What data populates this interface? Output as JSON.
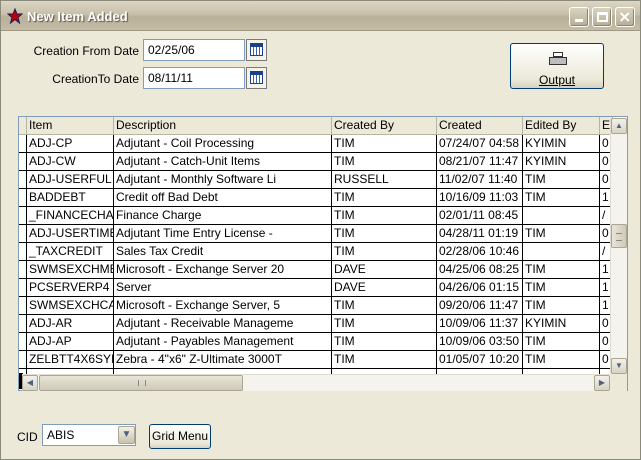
{
  "window": {
    "title": "New Item Added",
    "buttons": {
      "minimize": "minimize",
      "maximize": "maximize",
      "close": "×"
    }
  },
  "filters": {
    "creation_from_label": "Creation From Date",
    "creation_from_value": "02/25/06",
    "creation_to_label": "CreationTo Date",
    "creation_to_value": "08/11/11"
  },
  "output_button": {
    "label": "Output",
    "icon": "printer-icon"
  },
  "grid": {
    "columns": [
      "Item",
      "Description",
      "Created By",
      "Created",
      "Edited By",
      "Ec"
    ],
    "rows": [
      [
        "ADJ-CP",
        "Adjutant - Coil Processing",
        "TIM",
        "07/24/07 04:58",
        "KYIMIN",
        "0"
      ],
      [
        "ADJ-CW",
        "Adjutant - Catch-Unit Items",
        "TIM",
        "08/21/07 11:47",
        "KYIMIN",
        "0"
      ],
      [
        "ADJ-USERFUL",
        "Adjutant - Monthly Software Li",
        "RUSSELL",
        "11/02/07 11:40",
        "TIM",
        "0"
      ],
      [
        "BADDEBT",
        "Credit off Bad Debt",
        "TIM",
        "10/16/09 11:03",
        "TIM",
        "1"
      ],
      [
        "_FINANCECHA",
        "Finance Charge",
        "TIM",
        "02/01/11 08:45",
        "",
        "/"
      ],
      [
        "ADJ-USERTIME",
        "Adjutant Time Entry License -",
        "TIM",
        "04/28/11 01:19",
        "TIM",
        "0"
      ],
      [
        "_TAXCREDIT",
        "Sales Tax Credit",
        "TIM",
        "02/28/06 10:46",
        "",
        "/"
      ],
      [
        "SWMSEXCHME",
        "Microsoft - Exchange Server 20",
        "DAVE",
        "04/25/06 08:25",
        "TIM",
        "1"
      ],
      [
        "PCSERVERP4",
        "Server",
        "DAVE",
        "04/26/06 01:15",
        "TIM",
        "1"
      ],
      [
        "SWMSEXCHCA",
        "Microsoft - Exchange Server, 5",
        "TIM",
        "09/20/06 11:47",
        "TIM",
        "1"
      ],
      [
        "ADJ-AR",
        "Adjutant - Receivable Manageme",
        "TIM",
        "10/09/06 11:37",
        "KYIMIN",
        "0"
      ],
      [
        "ADJ-AP",
        "Adjutant - Payables Management",
        "TIM",
        "10/09/06 03:50",
        "TIM",
        "0"
      ],
      [
        "ZELBTT4X6SYI",
        "Zebra - 4\"x6\" Z-Ultimate 3000T",
        "TIM",
        "01/05/07 10:20",
        "TIM",
        "0"
      ],
      [
        "",
        "",
        "",
        "",
        "",
        ""
      ]
    ]
  },
  "cid": {
    "label": "CID",
    "value": "ABIS"
  },
  "grid_menu_button": {
    "label": "Grid Menu"
  },
  "colors": {
    "title_text": "#ffffff",
    "window_bg": "#ece9d8",
    "border_blue": "#003c74"
  }
}
